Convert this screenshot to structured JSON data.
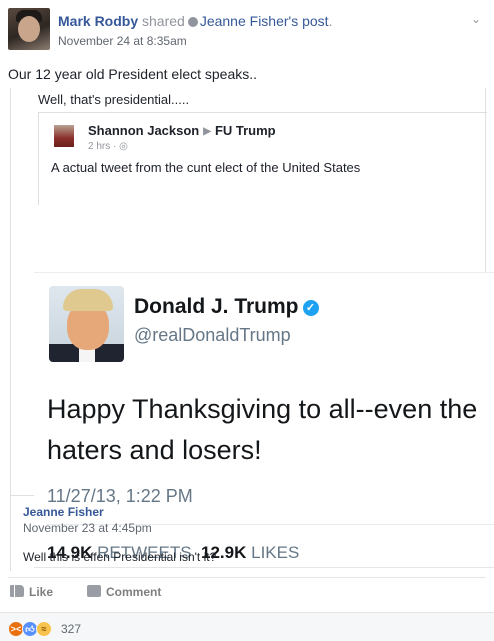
{
  "post": {
    "author": "Mark Rodby",
    "action": "shared",
    "original_author": "Jeanne Fisher's",
    "original_link": "post",
    "timestamp": "November 24 at 8:35am",
    "status": "Our 12 year old President elect speaks.."
  },
  "shared": {
    "caption": "Well, that's presidential.....",
    "inner": {
      "author": "Shannon Jackson",
      "target": "FU Trump",
      "meta": "2 hrs · ",
      "text": "A actual tweet from the cunt elect of the United States"
    }
  },
  "tweet": {
    "name": "Donald J. Trump",
    "handle": "@realDonaldTrump",
    "text": "Happy Thanksgiving to all--even the haters and losers!",
    "time": "11/27/13, 1:22 PM",
    "retweets_count": "14.9K",
    "retweets_label": "RETWEETS",
    "likes_count": "12.9K",
    "likes_label": "LIKES"
  },
  "comment": {
    "author": "Jeanne Fisher",
    "date": "November 23 at 4:45pm",
    "text": "Well this is effen Presidential isn't it?"
  },
  "actions": {
    "like_label": "Like",
    "comment_label": "Comment"
  },
  "reactions": {
    "count": "327",
    "icons": [
      "angry-icon",
      "like-icon",
      "haha-icon"
    ]
  },
  "colors": {
    "link": "#365899",
    "twitter_blue": "#1da1f2"
  }
}
